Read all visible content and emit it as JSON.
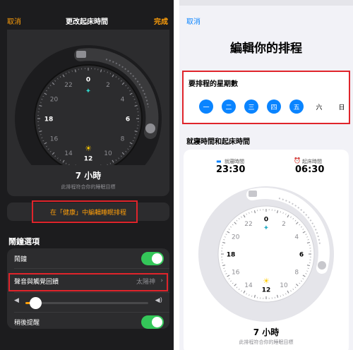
{
  "left": {
    "nav": {
      "cancel": "取消",
      "title": "更改起床時間",
      "done": "完成"
    },
    "clock": {
      "numbers": [
        "0",
        "2",
        "4",
        "6",
        "8",
        "10",
        "12",
        "14",
        "16",
        "18",
        "20",
        "22"
      ]
    },
    "duration": "7 小時",
    "goal_note": "此排程符合你的睡眠目標",
    "health_link": "在「健康」中編輯睡眠排程",
    "alarm_section": "鬧鐘選項",
    "alarm_row": {
      "label": "鬧鐘",
      "on": true
    },
    "sound_row": {
      "label": "聲音與觸覺回饋",
      "value": "太陽神"
    },
    "volume": 0.08,
    "snooze_row": {
      "label": "稍後提醒",
      "on": true
    }
  },
  "right": {
    "nav": {
      "cancel": "取消"
    },
    "title": "編輯你的排程",
    "days_heading": "要排程的星期數",
    "days": [
      {
        "label": "一",
        "on": true
      },
      {
        "label": "二",
        "on": true
      },
      {
        "label": "三",
        "on": true
      },
      {
        "label": "四",
        "on": true
      },
      {
        "label": "五",
        "on": true
      },
      {
        "label": "六",
        "on": false
      },
      {
        "label": "日",
        "on": false
      }
    ],
    "times_heading": "就寢時間和起床時間",
    "bedtime_label": "就寢時間",
    "bedtime": "23:30",
    "wake_label": "起床時間",
    "wake": "06:30",
    "clock": {
      "numbers": [
        "0",
        "2",
        "4",
        "6",
        "8",
        "10",
        "12",
        "14",
        "16",
        "18",
        "20",
        "22"
      ]
    },
    "duration": "7 小時",
    "goal_note": "此排程符合你的睡眠目標"
  },
  "colors": {
    "accent_orange": "#ff9f0a",
    "accent_blue": "#0a84ff",
    "toggle_green": "#34c759",
    "highlight_red": "#e0242b"
  }
}
